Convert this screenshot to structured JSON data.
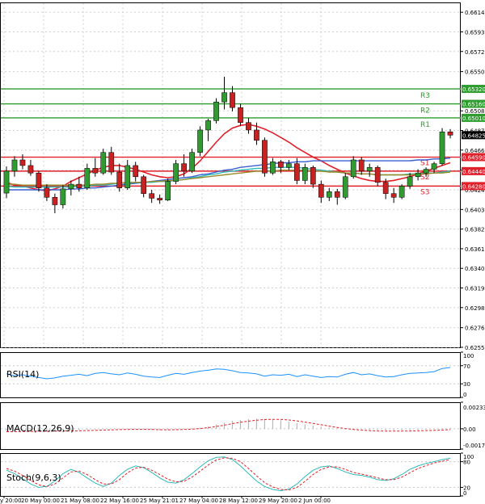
{
  "chart_data": {
    "type": "candlestick",
    "main_panel": {
      "price_ticks": [
        "0.66140",
        "0.65930",
        "0.65720",
        "0.65505",
        "0.65085",
        "0.64875",
        "0.64665",
        "0.64450",
        "0.64240",
        "0.64030",
        "0.63820",
        "0.63610",
        "0.63400",
        "0.63190",
        "0.62980",
        "0.62765",
        "0.62555"
      ],
      "ylim": [
        0.62555,
        0.66245
      ],
      "current_price": "0.64825",
      "levels": [
        {
          "name": "R3",
          "value": 0.6532,
          "label": "0.65320",
          "color": "#2e9c2e"
        },
        {
          "name": "R2",
          "value": 0.6516,
          "label": "0.65160",
          "color": "#2e9c2e"
        },
        {
          "name": "R1",
          "value": 0.6501,
          "label": "0.65010",
          "color": "#2e9c2e"
        },
        {
          "name": "S1",
          "value": 0.6459,
          "label": "0.64590",
          "color": "#e0202a"
        },
        {
          "name": "S2",
          "value": 0.6444,
          "label": "0.64440",
          "color": "#e0202a"
        },
        {
          "name": "S3",
          "value": 0.6428,
          "label": "0.64280",
          "color": "#e0202a"
        }
      ],
      "candles": [
        [
          0.64205,
          0.6449,
          0.6415,
          0.6444
        ],
        [
          0.6444,
          0.646,
          0.6438,
          0.6456
        ],
        [
          0.6456,
          0.6462,
          0.6446,
          0.645
        ],
        [
          0.645,
          0.6456,
          0.6439,
          0.6442
        ],
        [
          0.6442,
          0.6444,
          0.6422,
          0.6426
        ],
        [
          0.6426,
          0.643,
          0.6412,
          0.6416
        ],
        [
          0.6416,
          0.642,
          0.6399,
          0.6408
        ],
        [
          0.6408,
          0.6429,
          0.6404,
          0.6425
        ],
        [
          0.6425,
          0.6434,
          0.6418,
          0.643
        ],
        [
          0.643,
          0.6438,
          0.6422,
          0.6426
        ],
        [
          0.6426,
          0.6452,
          0.6424,
          0.6447
        ],
        [
          0.6447,
          0.6458,
          0.6438,
          0.6442
        ],
        [
          0.6442,
          0.6468,
          0.644,
          0.6464
        ],
        [
          0.6464,
          0.647,
          0.644,
          0.6443
        ],
        [
          0.6443,
          0.6452,
          0.6422,
          0.6426
        ],
        [
          0.6426,
          0.6456,
          0.6424,
          0.645
        ],
        [
          0.645,
          0.6454,
          0.6433,
          0.6438
        ],
        [
          0.6438,
          0.644,
          0.6416,
          0.642
        ],
        [
          0.642,
          0.6424,
          0.641,
          0.6415
        ],
        [
          0.6415,
          0.6419,
          0.6409,
          0.6413
        ],
        [
          0.6413,
          0.6436,
          0.6412,
          0.6433
        ],
        [
          0.6433,
          0.6456,
          0.643,
          0.6452
        ],
        [
          0.6452,
          0.6462,
          0.6438,
          0.6444
        ],
        [
          0.6444,
          0.6468,
          0.6442,
          0.6464
        ],
        [
          0.6464,
          0.6492,
          0.646,
          0.6488
        ],
        [
          0.6488,
          0.65,
          0.6476,
          0.6498
        ],
        [
          0.6498,
          0.6522,
          0.6495,
          0.6518
        ],
        [
          0.6518,
          0.6545,
          0.651,
          0.6528
        ],
        [
          0.6528,
          0.6535,
          0.6508,
          0.6512
        ],
        [
          0.6512,
          0.6516,
          0.6492,
          0.6496
        ],
        [
          0.6496,
          0.6501,
          0.6484,
          0.6488
        ],
        [
          0.6488,
          0.6496,
          0.6472,
          0.6477
        ],
        [
          0.6477,
          0.648,
          0.6438,
          0.6442
        ],
        [
          0.6442,
          0.6458,
          0.644,
          0.6454
        ],
        [
          0.6454,
          0.6456,
          0.6442,
          0.6448
        ],
        [
          0.6448,
          0.6456,
          0.6445,
          0.6452
        ],
        [
          0.6452,
          0.6458,
          0.643,
          0.6434
        ],
        [
          0.6434,
          0.6452,
          0.643,
          0.6448
        ],
        [
          0.6448,
          0.645,
          0.6426,
          0.643
        ],
        [
          0.643,
          0.6434,
          0.641,
          0.6416
        ],
        [
          0.6416,
          0.6426,
          0.6412,
          0.6422
        ],
        [
          0.6422,
          0.6425,
          0.6408,
          0.6416
        ],
        [
          0.6416,
          0.6442,
          0.6414,
          0.6438
        ],
        [
          0.6438,
          0.646,
          0.6436,
          0.6456
        ],
        [
          0.6456,
          0.6459,
          0.644,
          0.6444
        ],
        [
          0.6444,
          0.6452,
          0.6438,
          0.6448
        ],
        [
          0.6448,
          0.645,
          0.6428,
          0.6432
        ],
        [
          0.6432,
          0.6436,
          0.6414,
          0.642
        ],
        [
          0.642,
          0.6426,
          0.641,
          0.6416
        ],
        [
          0.6416,
          0.643,
          0.6414,
          0.6428
        ],
        [
          0.6428,
          0.6442,
          0.6425,
          0.6438
        ],
        [
          0.6438,
          0.6446,
          0.6434,
          0.6442
        ],
        [
          0.6442,
          0.6448,
          0.6438,
          0.6446
        ],
        [
          0.6446,
          0.6454,
          0.6442,
          0.6452
        ],
        [
          0.6452,
          0.649,
          0.645,
          0.6486
        ],
        [
          0.6486,
          0.6489,
          0.6479,
          0.64825
        ]
      ],
      "moving_averages": [
        {
          "name": "red",
          "color": "#e0202a",
          "values": [
            0.6432,
            0.6429,
            0.6428,
            0.6426,
            0.6424,
            0.6423,
            0.6425,
            0.6428,
            0.6433,
            0.6437,
            0.6441,
            0.6445,
            0.6448,
            0.645,
            0.645,
            0.6448,
            0.6446,
            0.6443,
            0.644,
            0.6438,
            0.6437,
            0.6438,
            0.6441,
            0.6447,
            0.6455,
            0.6465,
            0.6475,
            0.6484,
            0.649,
            0.6493,
            0.6494,
            0.6492,
            0.6489,
            0.6485,
            0.648,
            0.6475,
            0.6469,
            0.6464,
            0.6459,
            0.6455,
            0.645,
            0.6446,
            0.6442,
            0.6439,
            0.6436,
            0.6434,
            0.6433,
            0.6433,
            0.6434,
            0.6436,
            0.6438,
            0.6441,
            0.6444,
            0.6447,
            0.645,
            0.6453
          ]
        },
        {
          "name": "blue",
          "color": "#3a5fd0",
          "values": [
            0.6424,
            0.6424,
            0.6424,
            0.6424,
            0.6424,
            0.6424,
            0.6424,
            0.6424,
            0.6425,
            0.6425,
            0.6426,
            0.6426,
            0.6427,
            0.6428,
            0.6429,
            0.643,
            0.6431,
            0.6432,
            0.6433,
            0.6434,
            0.6435,
            0.6436,
            0.6437,
            0.6438,
            0.644,
            0.6441,
            0.6443,
            0.6445,
            0.6446,
            0.6448,
            0.6449,
            0.645,
            0.6451,
            0.6452,
            0.6453,
            0.6453,
            0.6454,
            0.6454,
            0.6455,
            0.6455,
            0.6455,
            0.6455,
            0.6455,
            0.6455,
            0.6455,
            0.6455,
            0.6455,
            0.6455,
            0.6455,
            0.6455,
            0.6455,
            0.6456,
            0.6456,
            0.6457,
            0.6457,
            0.6458
          ]
        },
        {
          "name": "cyan",
          "color": "#2fb9b9",
          "values": [
            0.6428,
            0.6427,
            0.6427,
            0.6427,
            0.6427,
            0.6427,
            0.6427,
            0.6427,
            0.6427,
            0.6428,
            0.6428,
            0.6429,
            0.6429,
            0.643,
            0.6431,
            0.6431,
            0.6432,
            0.6432,
            0.6432,
            0.6433,
            0.6433,
            0.6434,
            0.6435,
            0.6437,
            0.6438,
            0.644,
            0.6441,
            0.6443,
            0.6444,
            0.6445,
            0.6446,
            0.6447,
            0.6447,
            0.6448,
            0.6448,
            0.6448,
            0.6448,
            0.6447,
            0.6446,
            0.6445,
            0.6444,
            0.6443,
            0.6442,
            0.6442,
            0.6441,
            0.6441,
            0.644,
            0.644,
            0.644,
            0.644,
            0.6441,
            0.6441,
            0.6442,
            0.6442,
            0.6443,
            0.6444
          ]
        },
        {
          "name": "olive",
          "color": "#9a8a2a",
          "values": [
            0.643,
            0.643,
            0.6429,
            0.6429,
            0.6429,
            0.6429,
            0.6429,
            0.6429,
            0.6429,
            0.6429,
            0.6429,
            0.643,
            0.643,
            0.6431,
            0.6431,
            0.6432,
            0.6432,
            0.6432,
            0.6433,
            0.6433,
            0.6434,
            0.6434,
            0.6435,
            0.6436,
            0.6437,
            0.6438,
            0.6439,
            0.644,
            0.6441,
            0.6442,
            0.6443,
            0.6444,
            0.6444,
            0.6444,
            0.6445,
            0.6445,
            0.6445,
            0.6445,
            0.6444,
            0.6444,
            0.6443,
            0.6443,
            0.6442,
            0.6442,
            0.6441,
            0.6441,
            0.644,
            0.644,
            0.644,
            0.644,
            0.644,
            0.6441,
            0.6441,
            0.6442,
            0.6442,
            0.6443
          ]
        }
      ]
    },
    "x_ticks": [
      "y 20:00",
      "20 May 00:00",
      "21 May 08:00",
      "22 May 16:00",
      "25 May 21:01",
      "27 May 04:00",
      "28 May 12:00",
      "29 May 20:00",
      "2 Jun 00:00"
    ],
    "rsi_panel": {
      "label": "RSI(14)",
      "ticks": [
        "100",
        "70",
        "30",
        "0"
      ],
      "ylim": [
        0,
        100
      ],
      "levels": [
        70,
        30
      ],
      "color": "#1e90ff",
      "values": [
        52,
        48,
        50,
        47,
        44,
        41,
        43,
        47,
        49,
        51,
        48,
        53,
        55,
        52,
        50,
        54,
        51,
        47,
        45,
        44,
        49,
        53,
        51,
        55,
        58,
        60,
        63,
        62,
        59,
        55,
        54,
        52,
        47,
        50,
        49,
        51,
        46,
        50,
        47,
        44,
        46,
        45,
        51,
        55,
        50,
        52,
        48,
        45,
        46,
        50,
        53,
        54,
        55,
        57,
        64,
        66
      ]
    },
    "macd_panel": {
      "label": "MACD(12,26,9)",
      "ticks": [
        "0.00233",
        "0.00",
        "-0.00178"
      ],
      "ylim": [
        -0.00178,
        0.00233
      ],
      "histogram": [
        -0.0002,
        -0.00018,
        -0.00016,
        -0.00015,
        -0.00016,
        -0.00018,
        -0.00019,
        -0.00017,
        -0.00014,
        -0.00012,
        -0.0001,
        -6e-05,
        -2e-05,
        -2e-05,
        -4e-05,
        -2e-05,
        -3e-05,
        -6e-05,
        -0.0001,
        -0.00013,
        -0.00011,
        -6e-05,
        -3e-05,
        2e-05,
        0.0001,
        0.00022,
        0.00038,
        0.00055,
        0.0007,
        0.00078,
        0.00085,
        0.00088,
        0.00086,
        0.00082,
        0.00074,
        0.00062,
        0.0005,
        0.00038,
        0.00028,
        0.00018,
        0.0001,
        4e-05,
        -2e-05,
        -4e-05,
        -6e-05,
        -8e-05,
        -0.0001,
        -0.00012,
        -0.00013,
        -0.00012,
        -0.0001,
        -8e-05,
        -6e-05,
        -4e-05,
        4e-05,
        9e-05
      ],
      "signal_color": "#e0202a",
      "signal": [
        -0.00026,
        -0.00025,
        -0.00024,
        -0.00023,
        -0.00022,
        -0.00022,
        -0.00021,
        -0.0002,
        -0.00019,
        -0.00018,
        -0.00016,
        -0.00014,
        -0.00011,
        -9e-05,
        -7e-05,
        -6e-05,
        -5e-05,
        -5e-05,
        -6e-05,
        -8e-05,
        -9e-05,
        -8e-05,
        -6e-05,
        -3e-05,
        2e-05,
        0.0001,
        0.0002,
        0.00032,
        0.00045,
        0.00057,
        0.00067,
        0.00075,
        0.00081,
        0.00083,
        0.00082,
        0.00077,
        0.00069,
        0.00059,
        0.00047,
        0.00035,
        0.00023,
        0.00012,
        2e-05,
        -6e-05,
        -0.00012,
        -0.00016,
        -0.00019,
        -0.0002,
        -0.0002,
        -0.0002,
        -0.00019,
        -0.00018,
        -0.00016,
        -0.00014,
        -0.00011,
        -8e-05
      ]
    },
    "stoch_panel": {
      "label": "Stoch(9,6,3)",
      "ticks": [
        "100",
        "80",
        "20",
        "0"
      ],
      "ylim": [
        0,
        100
      ],
      "levels": [
        80,
        20
      ],
      "main_color": "#2fb9b9",
      "signal_color": "#e0202a",
      "main": [
        60,
        52,
        40,
        28,
        20,
        22,
        35,
        52,
        62,
        55,
        42,
        30,
        22,
        30,
        48,
        62,
        70,
        66,
        55,
        42,
        32,
        30,
        38,
        52,
        68,
        82,
        90,
        91,
        85,
        70,
        52,
        35,
        22,
        15,
        12,
        16,
        28,
        45,
        60,
        68,
        70,
        64,
        56,
        50,
        48,
        44,
        38,
        36,
        40,
        50,
        62,
        70,
        76,
        80,
        85,
        88
      ],
      "signal": [
        64,
        58,
        48,
        36,
        26,
        22,
        28,
        42,
        56,
        58,
        50,
        38,
        28,
        28,
        38,
        54,
        65,
        67,
        60,
        50,
        39,
        33,
        34,
        44,
        58,
        72,
        84,
        89,
        88,
        80,
        64,
        47,
        31,
        21,
        15,
        14,
        20,
        34,
        50,
        62,
        68,
        68,
        62,
        55,
        51,
        47,
        42,
        38,
        38,
        44,
        54,
        64,
        71,
        77,
        81,
        85
      ]
    }
  }
}
